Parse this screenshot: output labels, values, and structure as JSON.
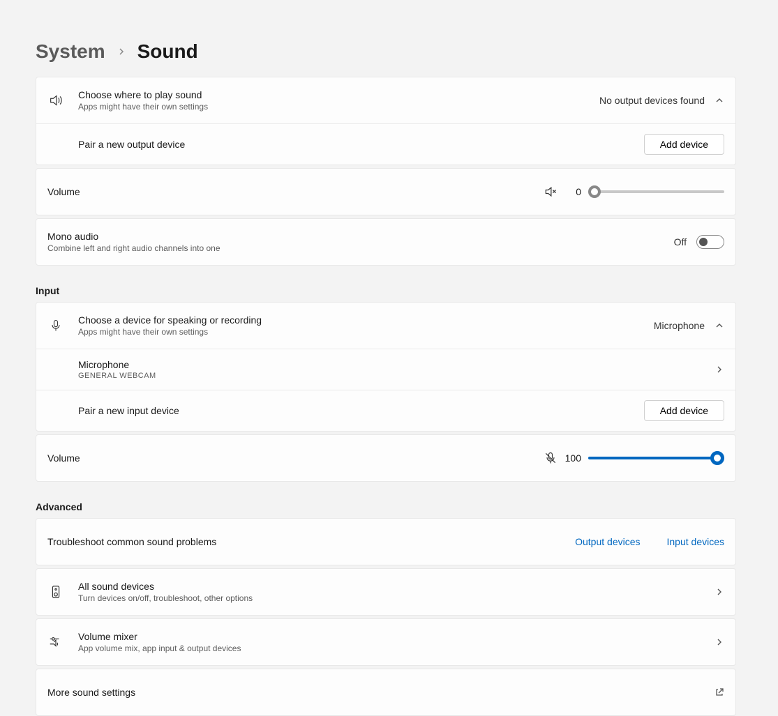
{
  "breadcrumb": {
    "parent": "System",
    "current": "Sound"
  },
  "output": {
    "header": {
      "title": "Choose where to play sound",
      "sub": "Apps might have their own settings",
      "status": "No output devices found"
    },
    "pair": {
      "label": "Pair a new output device",
      "button": "Add device"
    },
    "volume": {
      "label": "Volume",
      "value": "0"
    },
    "mono": {
      "title": "Mono audio",
      "sub": "Combine left and right audio channels into one",
      "state": "Off"
    }
  },
  "input_section_label": "Input",
  "input": {
    "header": {
      "title": "Choose a device for speaking or recording",
      "sub": "Apps might have their own settings",
      "status": "Microphone"
    },
    "device": {
      "name": "Microphone",
      "sub": "GENERAL WEBCAM"
    },
    "pair": {
      "label": "Pair a new input device",
      "button": "Add device"
    },
    "volume": {
      "label": "Volume",
      "value": "100"
    }
  },
  "advanced_label": "Advanced",
  "advanced": {
    "troubleshoot": {
      "title": "Troubleshoot common sound problems",
      "link_output": "Output devices",
      "link_input": "Input devices"
    },
    "all_devices": {
      "title": "All sound devices",
      "sub": "Turn devices on/off, troubleshoot, other options"
    },
    "mixer": {
      "title": "Volume mixer",
      "sub": "App volume mix, app input & output devices"
    },
    "more": {
      "title": "More sound settings"
    }
  }
}
